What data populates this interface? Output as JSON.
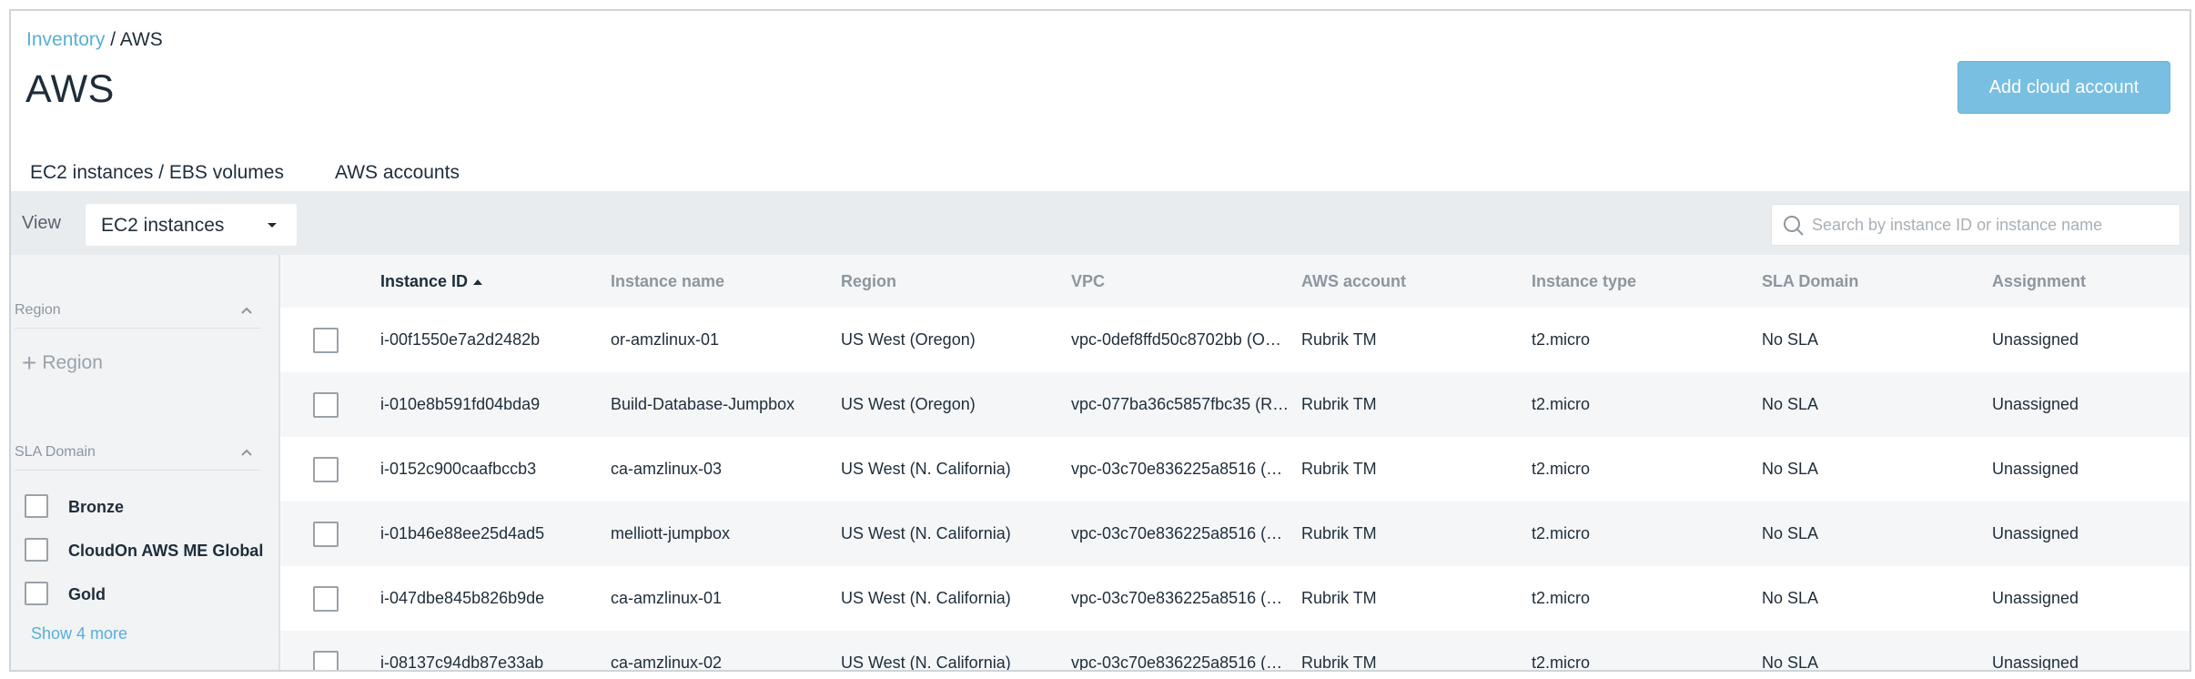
{
  "breadcrumb": {
    "parent": "Inventory",
    "separator": " / ",
    "current": "AWS"
  },
  "page_title": "AWS",
  "add_button_label": "Add cloud account",
  "tabs": [
    {
      "label": "EC2 instances / EBS volumes",
      "active": true
    },
    {
      "label": "AWS accounts",
      "active": false
    }
  ],
  "toolbar": {
    "view_label": "View",
    "view_value": "EC2 instances",
    "search_placeholder": "Search by instance ID or instance name"
  },
  "filters": {
    "region": {
      "title": "Region",
      "add_label": "Region"
    },
    "sla": {
      "title": "SLA Domain",
      "items": [
        "Bronze",
        "CloudOn AWS ME Global",
        "Gold"
      ],
      "show_more": "Show 4 more"
    }
  },
  "table": {
    "columns": [
      "Instance ID",
      "Instance name",
      "Region",
      "VPC",
      "AWS account",
      "Instance type",
      "SLA Domain",
      "Assignment"
    ],
    "sorted_column": "Instance ID",
    "rows": [
      [
        "i-00f1550e7a2d2482b",
        "or-amzlinux-01",
        "US West (Oregon)",
        "vpc-0def8ffd50c8702bb (O…",
        "Rubrik TM",
        "t2.micro",
        "No SLA",
        "Unassigned"
      ],
      [
        "i-010e8b591fd04bda9",
        "Build-Database-Jumpbox",
        "US West (Oregon)",
        "vpc-077ba36c5857fbc35 (R…",
        "Rubrik TM",
        "t2.micro",
        "No SLA",
        "Unassigned"
      ],
      [
        "i-0152c900caafbccb3",
        "ca-amzlinux-03",
        "US West (N. California)",
        "vpc-03c70e836225a8516 (…",
        "Rubrik TM",
        "t2.micro",
        "No SLA",
        "Unassigned"
      ],
      [
        "i-01b46e88ee25d4ad5",
        "melliott-jumpbox",
        "US West (N. California)",
        "vpc-03c70e836225a8516 (…",
        "Rubrik TM",
        "t2.micro",
        "No SLA",
        "Unassigned"
      ],
      [
        "i-047dbe845b826b9de",
        "ca-amzlinux-01",
        "US West (N. California)",
        "vpc-03c70e836225a8516 (…",
        "Rubrik TM",
        "t2.micro",
        "No SLA",
        "Unassigned"
      ],
      [
        "i-08137c94db87e33ab",
        "ca-amzlinux-02",
        "US West (N. California)",
        "vpc-03c70e836225a8516 (…",
        "Rubrik TM",
        "t2.micro",
        "No SLA",
        "Unassigned"
      ]
    ]
  },
  "colors": {
    "accent": "#3f97d0",
    "button": "#78bfe2",
    "link": "#5aaed8"
  },
  "icons": {
    "search": "search-icon",
    "sort": "sort-ascending-icon",
    "collapse": "chevron-up-icon",
    "add": "plus-icon"
  }
}
